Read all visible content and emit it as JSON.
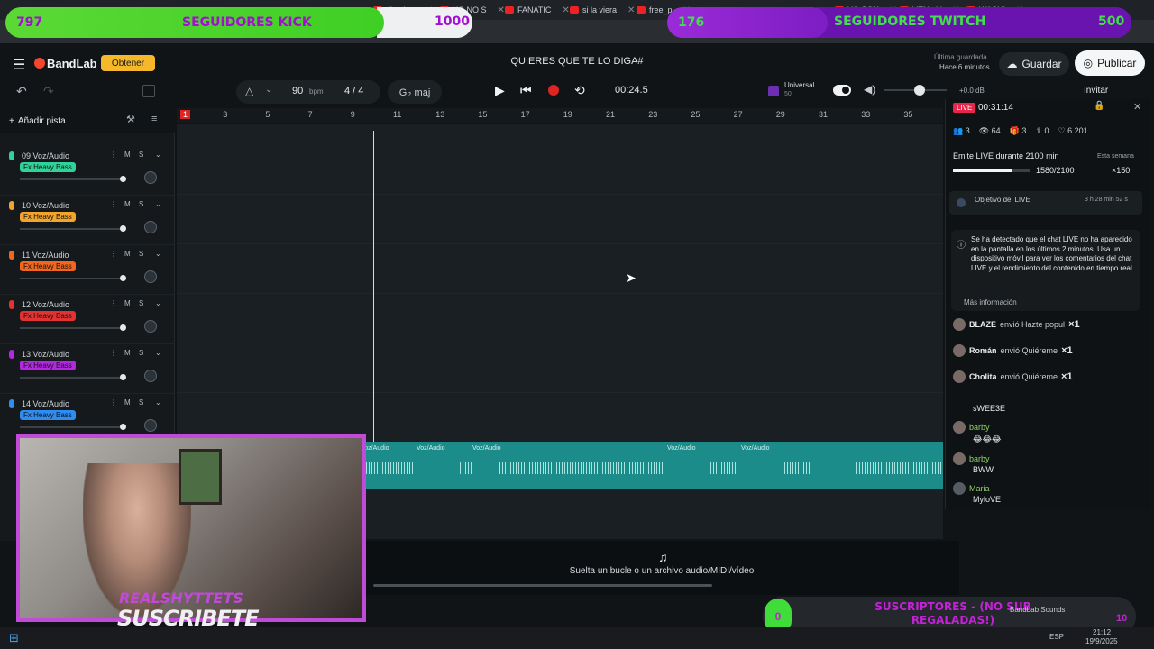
{
  "browser": {
    "tabs": [
      {
        "label": "dimelo m"
      },
      {
        "label": "YO NO S"
      },
      {
        "label": "FANATIC"
      },
      {
        "label": "si la viera"
      },
      {
        "label": "free_p"
      },
      {
        "label": "YO SOY"
      },
      {
        "label": "VEN - V"
      },
      {
        "label": "WASHI"
      }
    ]
  },
  "overlay": {
    "kick": {
      "count": "797",
      "label": "SEGUIDORES KICK",
      "goal": "1000",
      "progress": 0.797
    },
    "twitch": {
      "count": "176",
      "label": "SEGUIDORES TWITCH",
      "goal": "500",
      "progress": 0.352
    },
    "subs": {
      "count": "0",
      "label": "SUSCRIPTORES - (NO SUB REGALADAS!)",
      "goal": "10"
    },
    "webcam_text": {
      "line1": "REALSHYTTETS",
      "line2": "SUSCRIBETE"
    }
  },
  "app": {
    "logo": "BandLab",
    "obtener": "Obtener",
    "project_title": "QUIERES QUE TE LO DIGA#",
    "saved_line1": "Última guardada",
    "saved_line2": "Hace 6 minutos",
    "guardar": "Guardar",
    "publicar": "Publicar",
    "invitar": "Invitar",
    "bpm_value": "90",
    "bpm_unit": "bpm",
    "time_sig": "4 / 4",
    "key": "G♭ maj",
    "time": "00:24.5",
    "preset_name": "Universal",
    "preset_sub": "50",
    "volume_db": "+0.0 dB",
    "add_track": "Añadir pista",
    "drop_hint": "Suelta un bucle o un archivo audio/MIDI/vídeo",
    "sounds_label": "BandLab Sounds"
  },
  "ruler": [
    "1",
    "3",
    "5",
    "7",
    "9",
    "11",
    "13",
    "15",
    "17",
    "19",
    "21",
    "23",
    "25",
    "27",
    "29",
    "31",
    "33",
    "35"
  ],
  "tracks": [
    {
      "number": "09",
      "name": "Voz/Audio",
      "fx": "Fx Heavy Bass",
      "color": "#2fd39a"
    },
    {
      "number": "10",
      "name": "Voz/Audio",
      "fx": "Fx Heavy Bass",
      "color": "#f2a52a"
    },
    {
      "number": "11",
      "name": "Voz/Audio",
      "fx": "Fx Heavy Bass",
      "color": "#f2661f"
    },
    {
      "number": "12",
      "name": "Voz/Audio",
      "fx": "Fx Heavy Bass",
      "color": "#e23232"
    },
    {
      "number": "13",
      "name": "Voz/Audio",
      "fx": "Fx Heavy Bass",
      "color": "#b328e0"
    },
    {
      "number": "14",
      "name": "Voz/Audio",
      "fx": "Fx Heavy Bass",
      "color": "#2f8cf0"
    }
  ],
  "clip_labels": [
    "Voz/Audio",
    "Voz/Audio",
    "Voz/Audio",
    "Voz/Audio",
    "Voz/Audio"
  ],
  "live": {
    "badge": "LIVE",
    "timer": "00:31:14",
    "stats": {
      "viewers": "3",
      "views": "64",
      "gifts": "3",
      "shares": "0",
      "likes": "6.201"
    },
    "goal_text": "Emite LIVE durante 2100 min",
    "goal_progress": "1580/2100",
    "goal_fraction": 0.752,
    "week_label": "Esta semana",
    "reward": "×150",
    "objective_label": "Objetivo del LIVE",
    "objective_time": "3 h 28 min 52 s",
    "notice": "Se ha detectado que el chat LIVE no ha aparecido en la pantalla en los últimos 2 minutos. Usa un dispositivo móvil para ver los comentarios del chat LIVE y el rendimiento del contenido en tiempo real.",
    "more_info": "Más información",
    "gifts": [
      {
        "user": "BLAZE",
        "action": "envió Hazte popul",
        "mult": "×1"
      },
      {
        "user": "Román",
        "action": "envió Quiéreme",
        "mult": "×1"
      },
      {
        "user": "Cholita",
        "action": "envió Quiéreme",
        "mult": "×1"
      }
    ],
    "chat": [
      {
        "user": "",
        "message": "sWEE3E"
      },
      {
        "user": "barby",
        "message": "😂😂😂"
      },
      {
        "user": "barby",
        "message": "BWW"
      },
      {
        "user": "Maria",
        "message": "MyloVE"
      }
    ]
  },
  "taskbar": {
    "time": "21:12",
    "date": "19/9/2025",
    "lang": "ESP"
  }
}
